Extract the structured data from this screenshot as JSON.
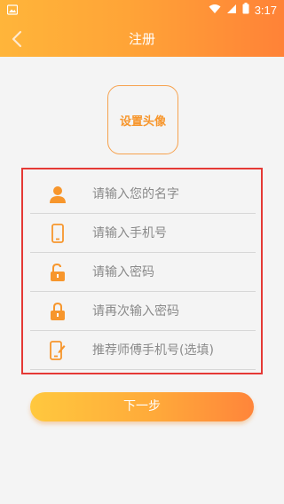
{
  "status_bar": {
    "time": "3:17"
  },
  "header": {
    "title": "注册",
    "back_icon": "chevron-left-icon"
  },
  "avatar": {
    "label": "设置头像"
  },
  "form": {
    "fields": [
      {
        "icon": "user-icon",
        "placeholder": "请输入您的名字"
      },
      {
        "icon": "phone-icon",
        "placeholder": "请输入手机号"
      },
      {
        "icon": "lock-open-icon",
        "placeholder": "请输入密码"
      },
      {
        "icon": "lock-icon",
        "placeholder": "请再次输入密码"
      },
      {
        "icon": "edit-phone-icon",
        "placeholder": "推荐师傅手机号(选填)"
      }
    ]
  },
  "next_button": {
    "label": "下一步"
  },
  "colors": {
    "accent": "#ff9f3a",
    "highlight_border": "#e53935",
    "placeholder_text": "#8a8a8a"
  }
}
